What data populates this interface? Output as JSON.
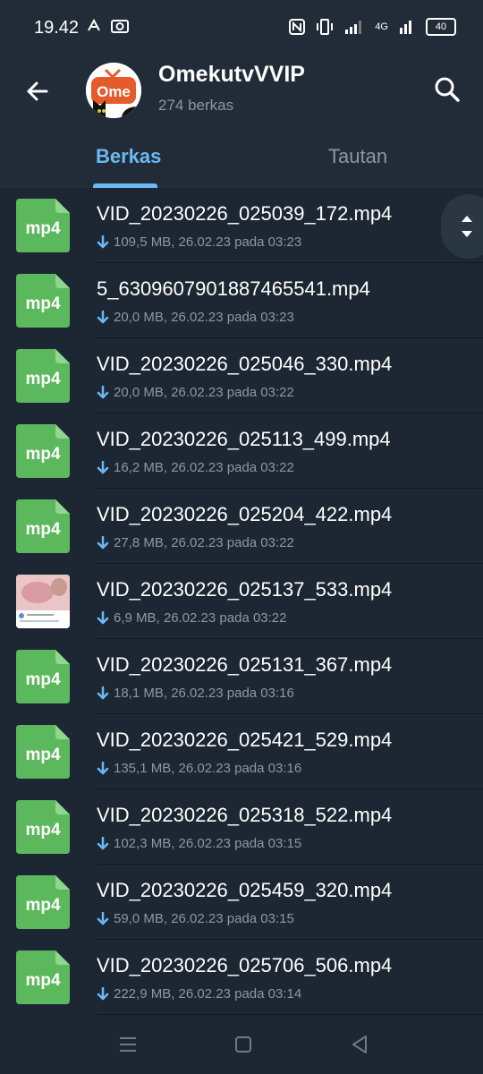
{
  "status_bar": {
    "time": "19.42",
    "network": "4G",
    "battery": "40"
  },
  "header": {
    "title": "OmekutvVVIP",
    "subtitle": "274 berkas",
    "avatar_text": "Ome"
  },
  "tabs": [
    {
      "label": "Berkas",
      "active": true
    },
    {
      "label": "Tautan",
      "active": false
    }
  ],
  "files": [
    {
      "name": "VID_20230226_025039_172.mp4",
      "meta": "109,5 MB, 26.02.23 pada 03:23",
      "icon": "mp4"
    },
    {
      "name": "5_6309607901887465541.mp4",
      "meta": "20,0 MB, 26.02.23 pada 03:23",
      "icon": "mp4"
    },
    {
      "name": "VID_20230226_025046_330.mp4",
      "meta": "20,0 MB, 26.02.23 pada 03:22",
      "icon": "mp4"
    },
    {
      "name": "VID_20230226_025113_499.mp4",
      "meta": "16,2 MB, 26.02.23 pada 03:22",
      "icon": "mp4"
    },
    {
      "name": "VID_20230226_025204_422.mp4",
      "meta": "27,8 MB, 26.02.23 pada 03:22",
      "icon": "mp4"
    },
    {
      "name": "VID_20230226_025137_533.mp4",
      "meta": "6,9 MB, 26.02.23 pada 03:22",
      "icon": "thumbnail"
    },
    {
      "name": "VID_20230226_025131_367.mp4",
      "meta": "18,1 MB, 26.02.23 pada 03:16",
      "icon": "mp4"
    },
    {
      "name": "VID_20230226_025421_529.mp4",
      "meta": "135,1 MB, 26.02.23 pada 03:16",
      "icon": "mp4"
    },
    {
      "name": "VID_20230226_025318_522.mp4",
      "meta": "102,3 MB, 26.02.23 pada 03:15",
      "icon": "mp4"
    },
    {
      "name": "VID_20230226_025459_320.mp4",
      "meta": "59,0 MB, 26.02.23 pada 03:15",
      "icon": "mp4"
    },
    {
      "name": "VID_20230226_025706_506.mp4",
      "meta": "222,9 MB, 26.02.23 pada 03:14",
      "icon": "mp4"
    }
  ],
  "colors": {
    "background": "#1d2733",
    "header_background": "#222c38",
    "accent": "#6cb8f2",
    "file_icon_green": "#5cb85c",
    "secondary_text": "#8a97a6"
  }
}
